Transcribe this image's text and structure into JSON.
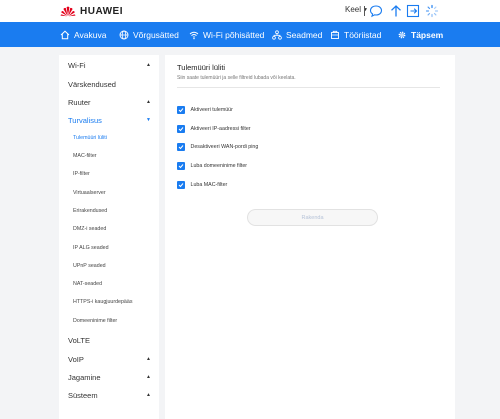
{
  "brand": {
    "name": "HUAWEI",
    "color": "#e3001b"
  },
  "topbar": {
    "language_label": "Keel",
    "icons": [
      "chat-icon",
      "update-arrow-icon",
      "logout-icon",
      "loading-spinner-icon"
    ]
  },
  "nav": {
    "items": [
      {
        "label": "Avakuva",
        "icon": "home-icon"
      },
      {
        "label": "Võrgusätted",
        "icon": "globe-icon"
      },
      {
        "label": "Wi-Fi põhisätted",
        "icon": "wifi-icon"
      },
      {
        "label": "Seadmed",
        "icon": "devices-icon"
      },
      {
        "label": "Tööriistad",
        "icon": "toolbox-icon"
      },
      {
        "label": "Täpsem",
        "icon": "gear-icon"
      }
    ],
    "active": "Täpsem",
    "accent": "#1a7cf0"
  },
  "sidebar": {
    "wifi": "Wi-Fi",
    "updates": "Värskendused",
    "router": "Ruuter",
    "security": "Turvalisus",
    "sub": [
      "Tulemüüri lüliti",
      "MAC-filter",
      "IP-filter",
      "Virtuaalserver",
      "Erirakendused",
      "DMZ-i seaded",
      "IP ALG seaded",
      "UPnP seaded",
      "NAT-seaded",
      "HTTPS-i kaugjuurdepääs",
      "Domeeninime filter"
    ],
    "volte": "VoLTE",
    "voip": "VoIP",
    "sharing": "Jagamine",
    "system": "Süsteem"
  },
  "content": {
    "title": "Tulemüüri lüliti",
    "description": "Siin saate tulemüüri ja selle filtreid lubada või keelata.",
    "checkboxes": [
      {
        "label": "Aktiveeri tulemüür",
        "checked": true
      },
      {
        "label": "Aktiveeri IP-aadressi filter",
        "checked": true
      },
      {
        "label": "Desaktiveeri WAN-pordi ping",
        "checked": true
      },
      {
        "label": "Luba domeeninime filter",
        "checked": true
      },
      {
        "label": "Luba MAC-filter",
        "checked": true
      }
    ],
    "apply_label": "Rakenda"
  }
}
